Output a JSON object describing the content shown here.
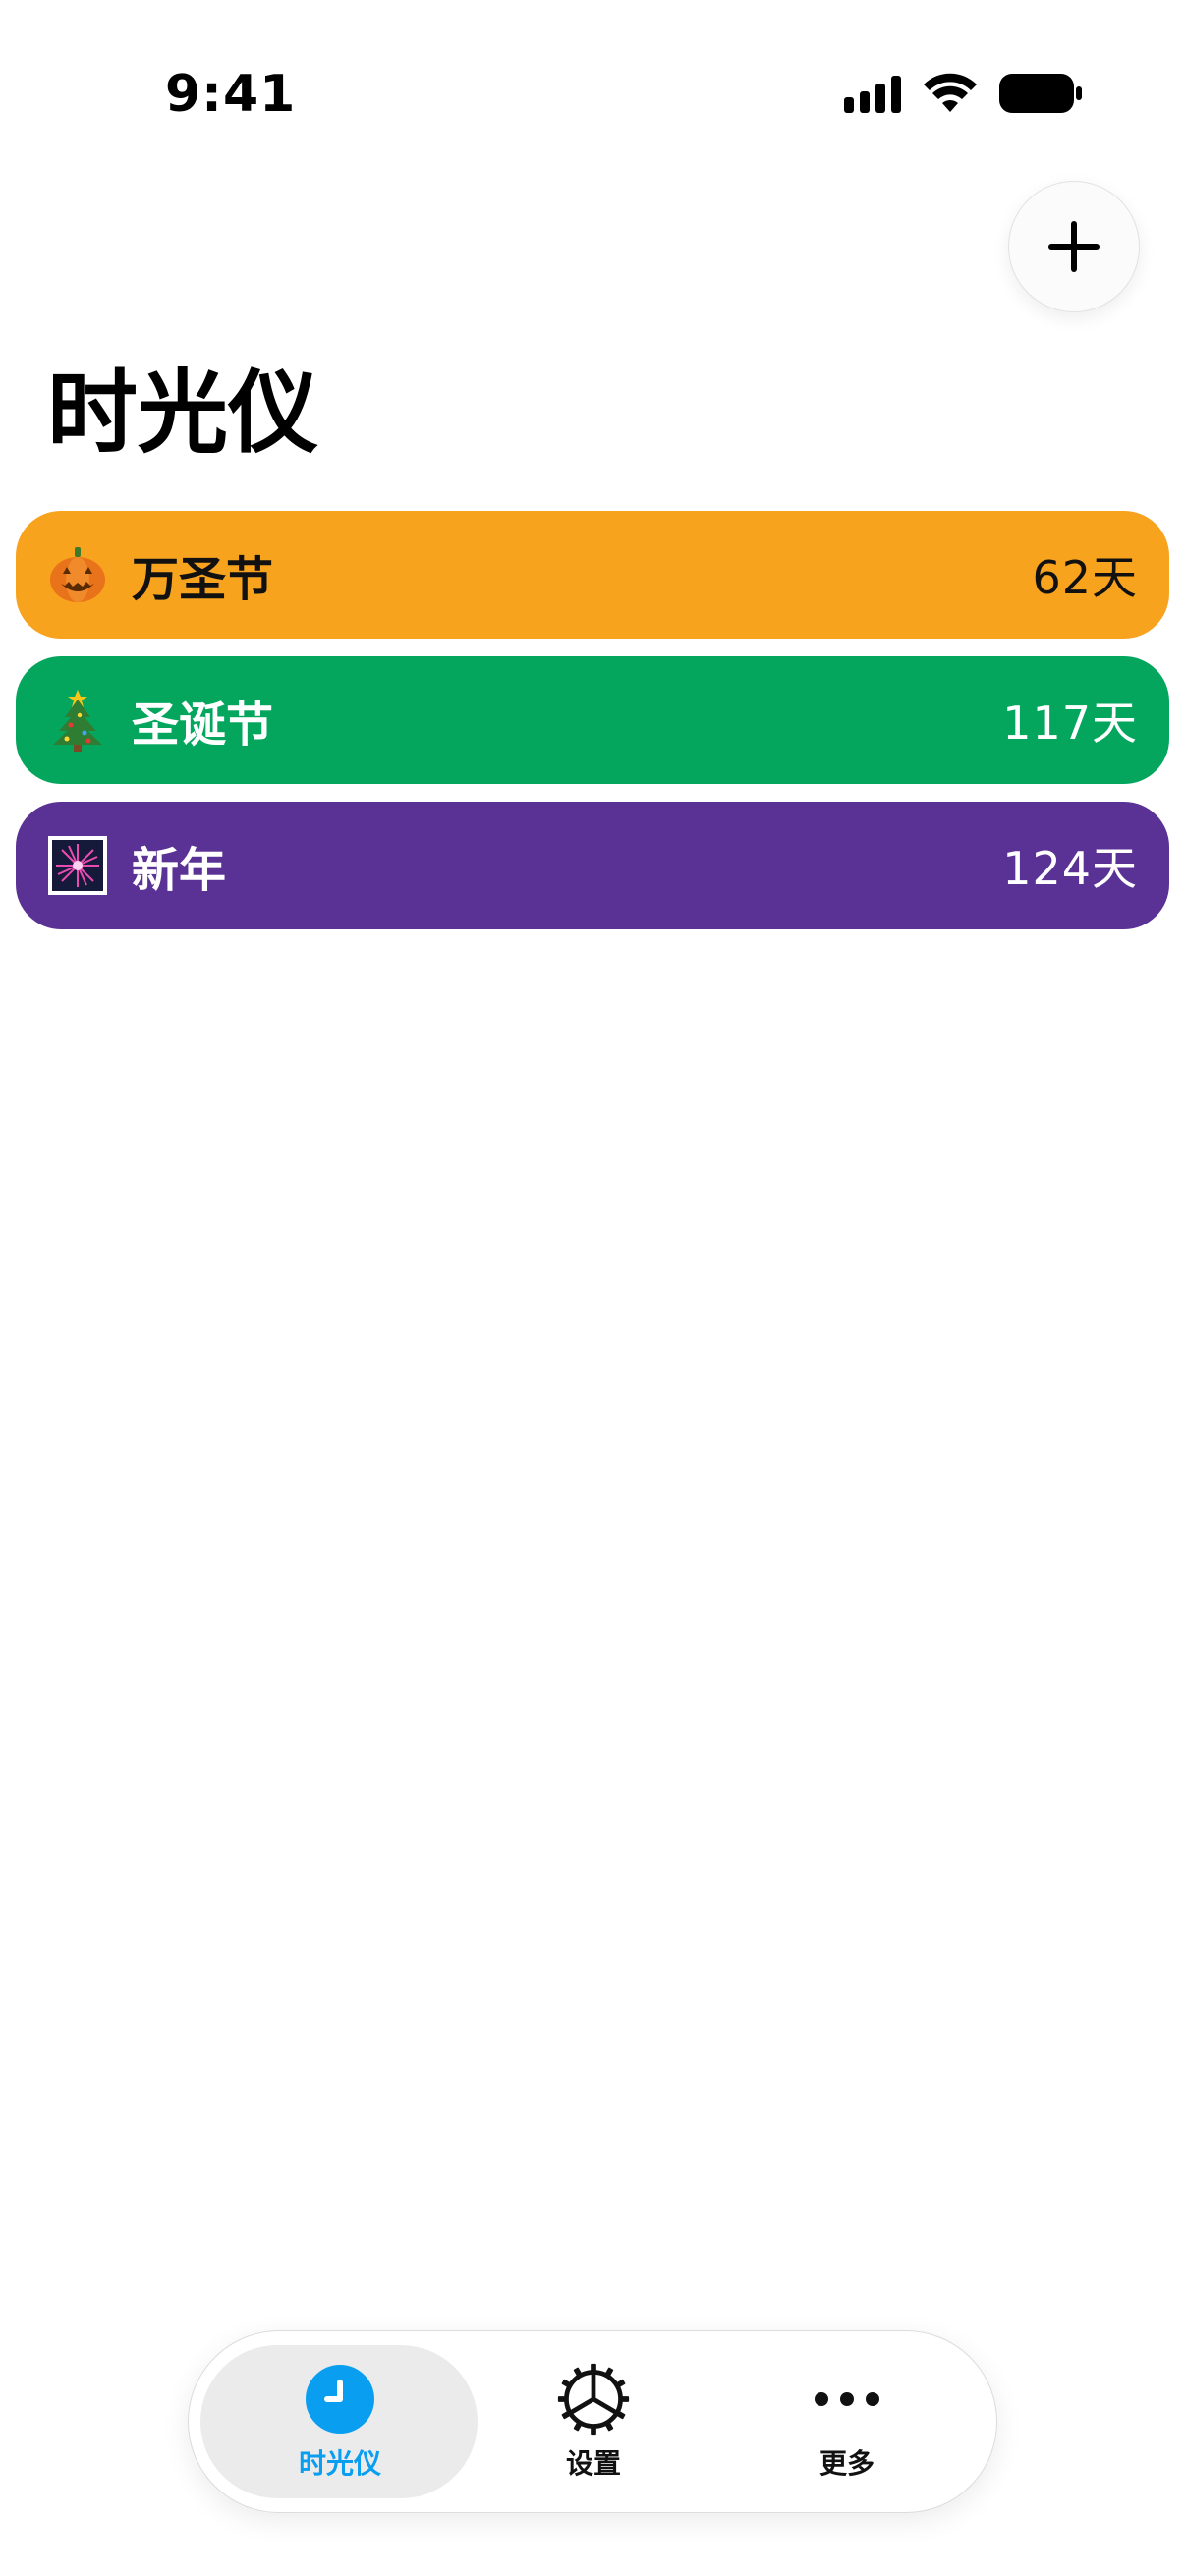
{
  "status_bar": {
    "time": "9:41"
  },
  "header": {
    "add_button_icon": "plus-icon",
    "title": "时光仪"
  },
  "events": [
    {
      "icon": "jack-o-lantern-icon",
      "name": "万圣节",
      "days": "62天",
      "color": "#F8A31E",
      "text_color": "#111111"
    },
    {
      "icon": "christmas-tree-icon",
      "name": "圣诞节",
      "days": "117天",
      "color": "#04A65E",
      "text_color": "#ffffff"
    },
    {
      "icon": "fireworks-icon",
      "name": "新年",
      "days": "124天",
      "color": "#5A3194",
      "text_color": "#ffffff"
    }
  ],
  "tab_bar": {
    "tabs": [
      {
        "label": "时光仪",
        "icon": "clock-icon",
        "selected": true,
        "color": "#0A9EF0"
      },
      {
        "label": "设置",
        "icon": "gear-icon",
        "selected": false,
        "color": "#111111"
      },
      {
        "label": "更多",
        "icon": "more-dots-icon",
        "selected": false,
        "color": "#111111"
      }
    ]
  }
}
